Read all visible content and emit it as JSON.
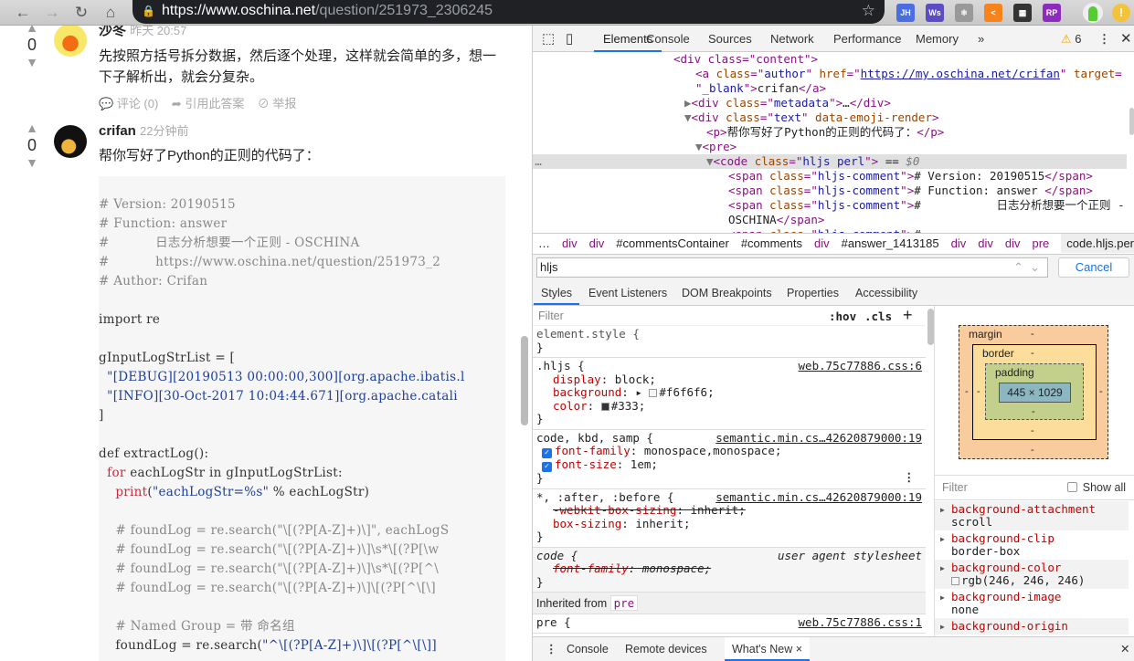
{
  "browser": {
    "url_host": "https://www.oschina.net",
    "url_path": "/question/251973_2306245",
    "extensions": [
      "JH",
      "Ws",
      "⚛",
      "<",
      "▦",
      "RP"
    ],
    "extension_colors": [
      "#4a6ee0",
      "#5b4bc4",
      "#999",
      "#f7831a",
      "#333",
      "#8e2bbf"
    ]
  },
  "answers": [
    {
      "votes": "0",
      "author": "沙冬",
      "time": "昨天 20:57",
      "text": "先按照方括号拆分数据，然后逐个处理，这样就会简单的多，想一下子解析出，就会分复杂。",
      "actions": [
        "评论 (0)",
        "引用此答案",
        "举报"
      ]
    },
    {
      "votes": "0",
      "author": "crifan",
      "time": "22分钟前",
      "text": "帮你写好了Python的正则的代码了："
    }
  ],
  "code_lines": [
    [
      [
        "c-com",
        "# Version: 20190515"
      ]
    ],
    [
      [
        "c-com",
        "# Function: answer"
      ]
    ],
    [
      [
        "c-com",
        "#           日志分析想要一个正则 - OSCHINA"
      ]
    ],
    [
      [
        "c-com",
        "#           https://www.oschina.net/question/251973_2"
      ]
    ],
    [
      [
        "c-com",
        "# Author: Crifan"
      ]
    ],
    [],
    [
      [
        "",
        "import re"
      ]
    ],
    [],
    [
      [
        "",
        "gInputLogStrList = ["
      ]
    ],
    [
      [
        "c-str",
        "  \"[DEBUG][20190513 00:00:00,300][org.apache.ibatis.l"
      ]
    ],
    [
      [
        "c-str",
        "  \"[INFO][30-Oct-2017 10:04:44.671][org.apache.catali"
      ]
    ],
    [
      [
        "",
        "]"
      ]
    ],
    [],
    [
      [
        "",
        "def extractLog():"
      ]
    ],
    [
      [
        "c-kw",
        "  for"
      ],
      [
        "",
        " eachLogStr in gInputLogStrList:"
      ]
    ],
    [
      [
        "c-kw",
        "    print"
      ],
      [
        "",
        "("
      ],
      [
        "c-str",
        "\"eachLogStr=%s\""
      ],
      [
        "",
        " % eachLogStr)"
      ]
    ],
    [],
    [
      [
        "c-com",
        "    # foundLog = re.search(\"\\[(?P[A-Z]+)\\]\", eachLogS"
      ]
    ],
    [
      [
        "c-com",
        "    # foundLog = re.search(\"\\[(?P[A-Z]+)\\]\\s*\\[(?P[\\w"
      ]
    ],
    [
      [
        "c-com",
        "    # foundLog = re.search(\"\\[(?P[A-Z]+)\\]\\s*\\[(?P[^\\"
      ]
    ],
    [
      [
        "c-com",
        "    # foundLog = re.search(\"\\[(?P[A-Z]+)\\]\\[(?P[^\\[\\]"
      ]
    ],
    [],
    [
      [
        "c-com",
        "    # Named Group = 带 命名组"
      ]
    ],
    [
      [
        "",
        "    foundLog = re.search("
      ],
      [
        "c-str",
        "\"^\\[(?P[A-Z]+)\\]\\[(?P[^\\[\\]]"
      ]
    ]
  ],
  "devtools": {
    "tabs": [
      "Elements",
      "Console",
      "Sources",
      "Network",
      "Performance",
      "Memory",
      "»"
    ],
    "warnings": "6",
    "dom_lines": [
      {
        "i": 13,
        "hl": false,
        "s": [
          [
            "t",
            "<div class=\"content\">"
          ]
        ]
      },
      {
        "i": 15,
        "hl": false,
        "s": [
          [
            "t",
            "<a "
          ],
          [
            "a",
            "class"
          ],
          [
            "t",
            "=\""
          ],
          [
            "v",
            "author"
          ],
          [
            "t",
            "\" "
          ],
          [
            "a",
            "href"
          ],
          [
            "t",
            "=\""
          ],
          [
            "lnk",
            "https://my.oschina.net/crifan"
          ],
          [
            "t",
            "\" "
          ],
          [
            "a",
            "target"
          ],
          [
            "t",
            "="
          ]
        ]
      },
      {
        "i": 15,
        "hl": false,
        "s": [
          [
            "t",
            "\""
          ],
          [
            "v",
            "_blank"
          ],
          [
            "t",
            "\">"
          ],
          [
            "tx",
            "crifan"
          ],
          [
            "t",
            "</a>"
          ]
        ]
      },
      {
        "i": 14,
        "hl": false,
        "s": [
          [
            "g",
            "▶"
          ],
          [
            "t",
            "<div "
          ],
          [
            "a",
            "class"
          ],
          [
            "t",
            "=\""
          ],
          [
            "v",
            "metadata"
          ],
          [
            "t",
            "\">"
          ],
          [
            "tx",
            "…"
          ],
          [
            "t",
            "</div>"
          ]
        ]
      },
      {
        "i": 14,
        "hl": false,
        "s": [
          [
            "g",
            "▼"
          ],
          [
            "t",
            "<div "
          ],
          [
            "a",
            "class"
          ],
          [
            "t",
            "=\""
          ],
          [
            "v",
            "text"
          ],
          [
            "t",
            "\" "
          ],
          [
            "a",
            "data-emoji-render"
          ],
          [
            "t",
            ">"
          ]
        ]
      },
      {
        "i": 16,
        "hl": false,
        "s": [
          [
            "t",
            "<p>"
          ],
          [
            "tx",
            "帮你写好了Python的正则的代码了："
          ],
          [
            "t",
            "</p>"
          ]
        ]
      },
      {
        "i": 15,
        "hl": false,
        "s": [
          [
            "g",
            "▼"
          ],
          [
            "t",
            "<pre>"
          ]
        ]
      },
      {
        "i": 16,
        "hl": true,
        "s": [
          [
            "g",
            "▼"
          ],
          [
            "t",
            "<code "
          ],
          [
            "a",
            "class"
          ],
          [
            "t",
            "=\""
          ],
          [
            "v",
            "hljs perl"
          ],
          [
            "t",
            "\">"
          ],
          [
            "tx",
            " == "
          ],
          [
            "g",
            "$0"
          ]
        ]
      },
      {
        "i": 18,
        "hl": false,
        "s": [
          [
            "t",
            "<span "
          ],
          [
            "a",
            "class"
          ],
          [
            "t",
            "=\""
          ],
          [
            "v",
            "hljs-comment"
          ],
          [
            "t",
            "\">"
          ],
          [
            "tx",
            "# Version: 20190515"
          ],
          [
            "t",
            "</span>"
          ]
        ]
      },
      {
        "i": 18,
        "hl": false,
        "s": [
          [
            "t",
            "<span "
          ],
          [
            "a",
            "class"
          ],
          [
            "t",
            "=\""
          ],
          [
            "v",
            "hljs-comment"
          ],
          [
            "t",
            "\">"
          ],
          [
            "tx",
            "# Function: answer "
          ],
          [
            "t",
            "</span>"
          ]
        ]
      },
      {
        "i": 18,
        "hl": false,
        "s": [
          [
            "t",
            "<span "
          ],
          [
            "a",
            "class"
          ],
          [
            "t",
            "=\""
          ],
          [
            "v",
            "hljs-comment"
          ],
          [
            "t",
            "\">"
          ],
          [
            "tx",
            "#           日志分析想要一个正则 -"
          ]
        ]
      },
      {
        "i": 18,
        "hl": false,
        "s": [
          [
            "tx",
            "OSCHINA"
          ],
          [
            "t",
            "</span>"
          ]
        ]
      },
      {
        "i": 18,
        "hl": false,
        "s": [
          [
            "t",
            "<span "
          ],
          [
            "a",
            "class"
          ],
          [
            "t",
            "=\""
          ],
          [
            "v",
            "hljs-comment"
          ],
          [
            "t",
            "\">"
          ],
          [
            "tx",
            "#"
          ]
        ]
      }
    ],
    "breadcrumbs": [
      "…",
      "div",
      "div",
      "#commentsContainer",
      "#comments",
      "div",
      "#answer_1413185",
      "div",
      "div",
      "div",
      "pre",
      "code.hljs.perl"
    ],
    "search_value": "hljs",
    "cancel_label": "Cancel",
    "side_tabs": [
      "Styles",
      "Event Listeners",
      "DOM Breakpoints",
      "Properties",
      "Accessibility"
    ],
    "filter_placeholder": "Filter",
    "hov": ":hov",
    "cls": ".cls",
    "plus": "+",
    "rules": [
      {
        "sel": "element.style {",
        "src": "",
        "props": []
      },
      {
        "sel": ".hljs {",
        "src": "web.75c77886.css:6",
        "props": [
          {
            "n": "display",
            "v": "block;"
          },
          {
            "n": "background",
            "v": "#f6f6f6;",
            "sw": "#f6f6f6",
            "arrow": true
          },
          {
            "n": "color",
            "v": "#333;",
            "sw": "#333333"
          }
        ]
      },
      {
        "sel": "code, kbd, samp {",
        "src": "semantic.min.cs…42620879000:19",
        "props": [
          {
            "n": "font-family",
            "v": "monospace,monospace;",
            "cb": true
          },
          {
            "n": "font-size",
            "v": "1em;",
            "cb": true
          }
        ]
      },
      {
        "sel": "*, :after, :before {",
        "src": "semantic.min.cs…42620879000:19",
        "props": [
          {
            "n": "-webkit-box-sizing",
            "v": "inherit;",
            "strike": true
          },
          {
            "n": "box-sizing",
            "v": "inherit;"
          }
        ]
      },
      {
        "sel": "code {",
        "src": "user agent stylesheet",
        "ua": true,
        "props": [
          {
            "n": "font-family",
            "v": "monospace;",
            "strike": true
          }
        ]
      }
    ],
    "inherited_label": "Inherited from",
    "inherited_tag": "pre",
    "last_rule": {
      "sel": "pre {",
      "src": "web.75c77886.css:1"
    },
    "box_model": {
      "margin": "margin",
      "border": "border",
      "padding": "padding",
      "content": "445 × 1029",
      "dash": "-"
    },
    "computed_filter": "Filter",
    "show_all": "Show all",
    "computed": [
      {
        "n": "background-attachment",
        "v": "scroll"
      },
      {
        "n": "background-clip",
        "v": "border-box"
      },
      {
        "n": "background-color",
        "v": "rgb(246, 246, 246)",
        "sw": true
      },
      {
        "n": "background-image",
        "v": "none"
      },
      {
        "n": "background-origin",
        "v": ""
      }
    ],
    "drawer_tabs": [
      "Console",
      "Remote devices",
      "What's New"
    ]
  }
}
